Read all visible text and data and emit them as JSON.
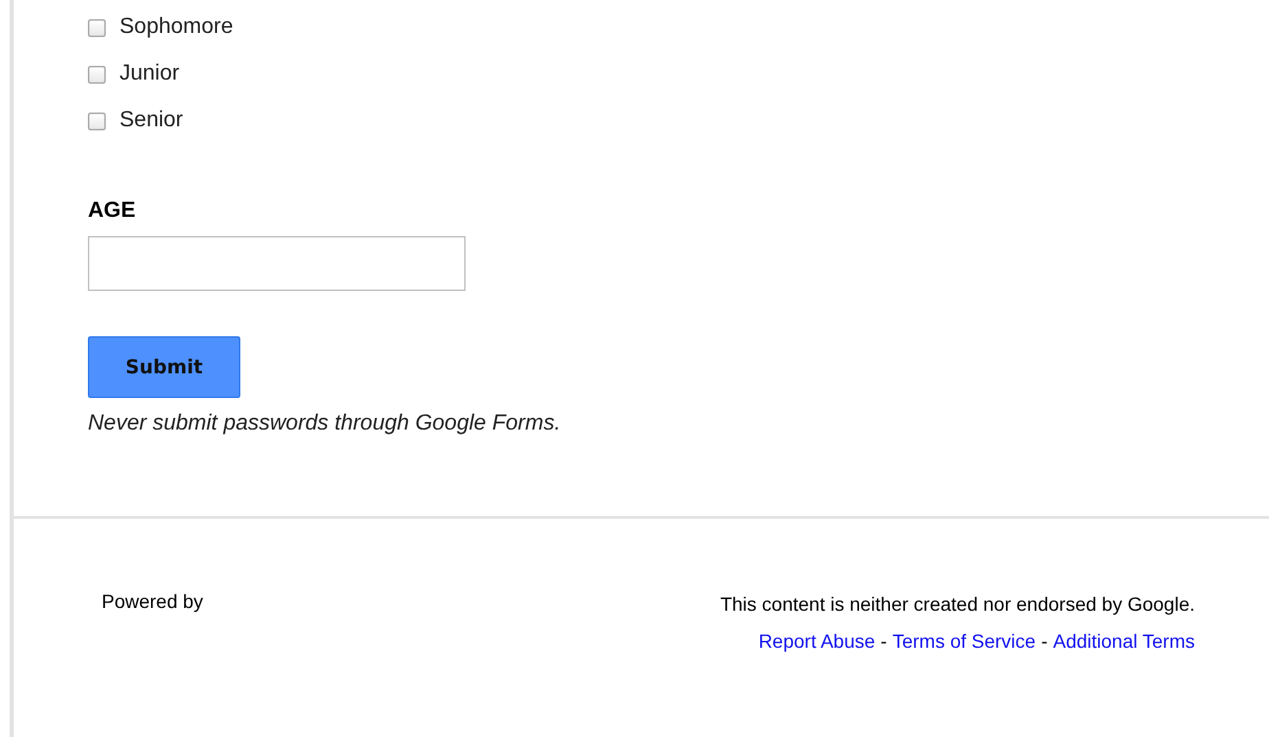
{
  "options": [
    {
      "label": "Sophomore",
      "checked": false
    },
    {
      "label": "Junior",
      "checked": false
    },
    {
      "label": "Senior",
      "checked": false
    }
  ],
  "age_question": {
    "label": "AGE"
  },
  "submit_button": "Submit",
  "password_warning": "Never submit passwords through Google Forms.",
  "footer": {
    "powered_by": "Powered by",
    "disclaimer": "This content is neither created nor endorsed by Google.",
    "links": [
      {
        "kind": "link",
        "text": "Report Abuse"
      },
      {
        "kind": "separator",
        "text": "-"
      },
      {
        "kind": "link",
        "text": "Terms of Service"
      },
      {
        "kind": "separator",
        "text": "-"
      },
      {
        "kind": "link",
        "text": "Additional Terms"
      }
    ]
  }
}
